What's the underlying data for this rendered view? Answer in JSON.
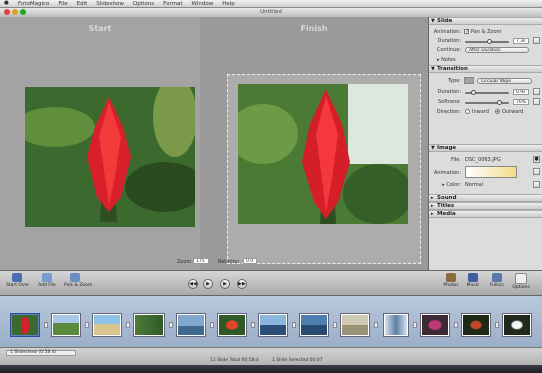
{
  "menubar": {
    "apple": "",
    "items": [
      "FotoMagico",
      "File",
      "Edit",
      "Slideshow",
      "Options",
      "Format",
      "Window",
      "Help"
    ]
  },
  "window": {
    "title": "Untitled"
  },
  "preview": {
    "start_label": "Start",
    "finish_label": "Finish",
    "zoom_label": "Zoom",
    "zoom_value": "175",
    "rotation_label": "Rotation",
    "rotation_value": "0.0"
  },
  "inspector": {
    "slide": {
      "title": "Slide",
      "animation_label": "Animation:",
      "animation_option": "Pan & Zoom",
      "animation_checked": true,
      "duration_label": "Duration:",
      "duration_value": "7.3s",
      "continue_label": "Continue:",
      "continue_value": "After Duration",
      "notes_label": "Notes"
    },
    "transition": {
      "title": "Transition",
      "type_label": "Type:",
      "type_value": "Circular Wipe",
      "duration_label": "Duration:",
      "duration_value": "0.9s",
      "softness_label": "Softness:",
      "softness_value": "70%",
      "direction_label": "Direction:",
      "direction_inward": "Inward",
      "direction_outward": "Outward",
      "direction_selected": "Outward"
    },
    "image": {
      "title": "Image",
      "file_label": "File:",
      "file_value": "DSC_0063.JPG",
      "animation_label": "Animation:",
      "color_label": "Color:",
      "color_value": "Normal"
    },
    "sections": [
      "Sound",
      "Titles",
      "Media"
    ]
  },
  "toolbar": {
    "left_buttons": [
      "Start Over",
      "Add File",
      "Pick & Zoom"
    ],
    "right_buttons": [
      "Photos",
      "Music",
      "Fullscr",
      "Options"
    ]
  },
  "filmstrip": {
    "slide_count": 14,
    "selected_index": 0
  },
  "status": {
    "left": "1 Slideshow (0:58:4)",
    "center_left": "11 Slide Total 00:58:4",
    "center_right": "1 Slide Selected 00:07"
  }
}
